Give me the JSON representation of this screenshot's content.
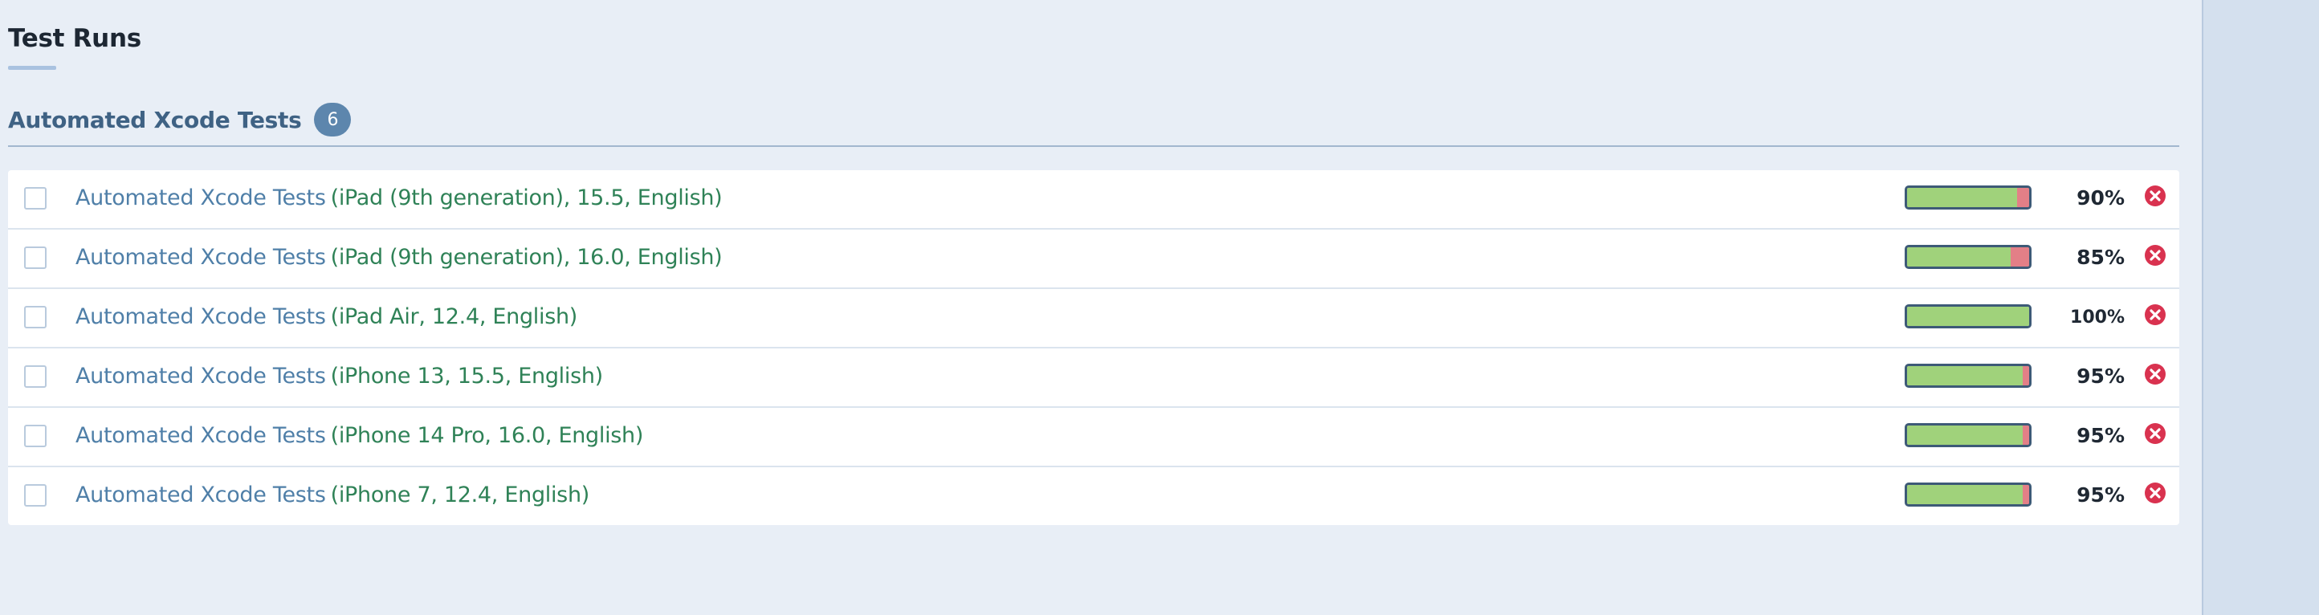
{
  "page": {
    "title": "Test Runs"
  },
  "section": {
    "title": "Automated Xcode Tests",
    "count": "6"
  },
  "colors": {
    "pass": "#a0d27b",
    "fail": "#e37f87",
    "delete": "#d9324f",
    "link": "#4f7fa8",
    "config": "#2f8257"
  },
  "runs": [
    {
      "name": "Automated Xcode Tests",
      "config": "(iPad (9th generation), 15.5, English)",
      "percent": "90%",
      "pass_fraction": 0.9,
      "delete_icon": "delete-icon"
    },
    {
      "name": "Automated Xcode Tests",
      "config": "(iPad (9th generation), 16.0, English)",
      "percent": "85%",
      "pass_fraction": 0.85,
      "delete_icon": "delete-icon"
    },
    {
      "name": "Automated Xcode Tests",
      "config": "(iPad Air, 12.4, English)",
      "percent": "100%",
      "pass_fraction": 1.0,
      "delete_icon": "delete-icon"
    },
    {
      "name": "Automated Xcode Tests",
      "config": "(iPhone 13, 15.5, English)",
      "percent": "95%",
      "pass_fraction": 0.95,
      "delete_icon": "delete-icon"
    },
    {
      "name": "Automated Xcode Tests",
      "config": "(iPhone 14 Pro, 16.0, English)",
      "percent": "95%",
      "pass_fraction": 0.95,
      "delete_icon": "delete-icon"
    },
    {
      "name": "Automated Xcode Tests",
      "config": "(iPhone 7, 12.4, English)",
      "percent": "95%",
      "pass_fraction": 0.95,
      "delete_icon": "delete-icon"
    }
  ]
}
